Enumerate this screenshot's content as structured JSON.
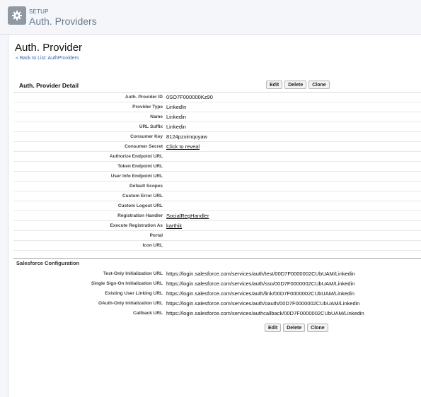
{
  "header": {
    "section_label": "SETUP",
    "title": "Auth. Providers",
    "icon": "gear-icon"
  },
  "page": {
    "title": "Auth. Provider",
    "back_link": "« Back to List: AuthProviders"
  },
  "detail": {
    "section_title": "Auth. Provider Detail",
    "buttons": {
      "edit": "Edit",
      "delete": "Delete",
      "clone": "Clone"
    },
    "fields": [
      {
        "label": "Auth. Provider ID",
        "value": "0SO7F000000Kz90",
        "link": false
      },
      {
        "label": "Provider Type",
        "value": "LinkedIn",
        "link": false
      },
      {
        "label": "Name",
        "value": "Linkedin",
        "link": false
      },
      {
        "label": "URL Suffix",
        "value": "Linkedin",
        "link": false
      },
      {
        "label": "Consumer Key",
        "value": "8124pzximquyaw",
        "link": false
      },
      {
        "label": "Consumer Secret",
        "value": "Click to reveal",
        "link": true
      },
      {
        "label": "Authorize Endpoint URL",
        "value": "",
        "link": false
      },
      {
        "label": "Token Endpoint URL",
        "value": "",
        "link": false
      },
      {
        "label": "User Info Endpoint URL",
        "value": "",
        "link": false
      },
      {
        "label": "Default Scopes",
        "value": "",
        "link": false
      },
      {
        "label": "Custom Error URL",
        "value": "",
        "link": false
      },
      {
        "label": "Custom Logout URL",
        "value": "",
        "link": false
      },
      {
        "label": "Registration Handler",
        "value": "SocialRegHandler",
        "link": true
      },
      {
        "label": "Execute Registration As",
        "value": "karthik",
        "link": true
      },
      {
        "label": "Portal",
        "value": "",
        "link": false
      },
      {
        "label": "Icon URL",
        "value": "",
        "link": false
      }
    ]
  },
  "salesforce": {
    "section_title": "Salesforce Configuration",
    "fields": [
      {
        "label": "Test-Only Initialization URL",
        "value": "https://login.salesforce.com/services/auth/test/00D7F0000002CUbUAM/Linkedin"
      },
      {
        "label": "Single Sign-On Initialization URL",
        "value": "https://login.salesforce.com/services/auth/sso/00D7F0000002CUbUAM/Linkedin"
      },
      {
        "label": "Existing User Linking URL",
        "value": "https://login.salesforce.com/services/auth/link/00D7F0000002CUbUAM/Linkedin"
      },
      {
        "label": "OAuth-Only Initialization URL",
        "value": "https://login.salesforce.com/services/auth/oauth/00D7F0000002CUbUAM/Linkedin"
      },
      {
        "label": "Callback URL",
        "value": "https://login.salesforce.com/services/authcallback/00D7F0000002CUbUAM/Linkedin"
      }
    ],
    "buttons": {
      "edit": "Edit",
      "delete": "Delete",
      "clone": "Clone"
    }
  }
}
